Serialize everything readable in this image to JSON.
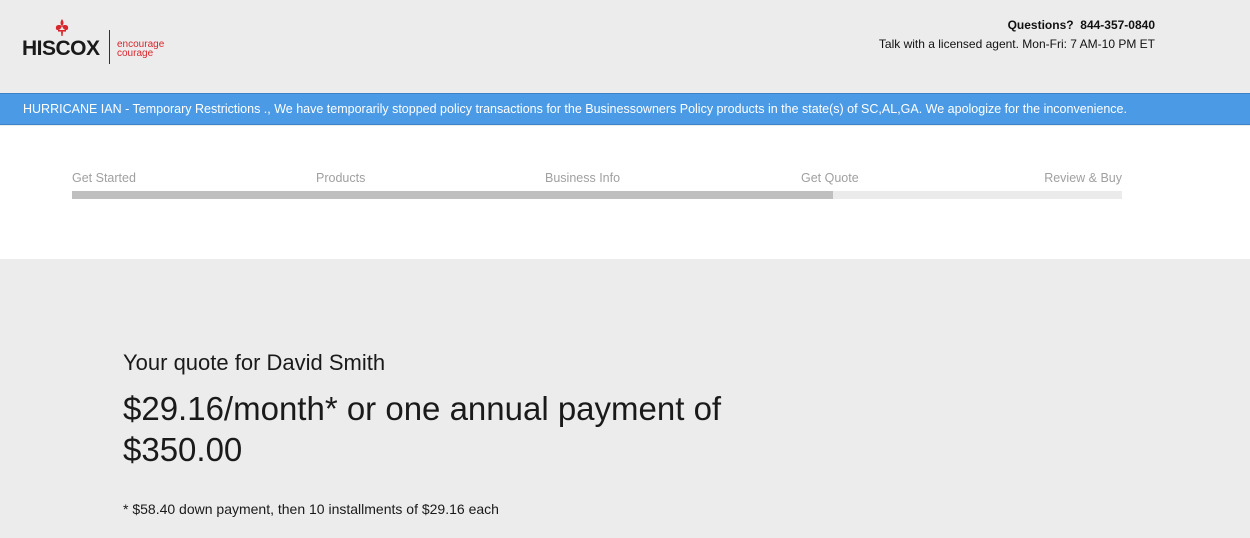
{
  "header": {
    "logo_text": "HISCOX",
    "logo_tagline_1": "encourage",
    "logo_tagline_2": "courage",
    "contact_label": "Questions?",
    "contact_phone": "844-357-0840",
    "contact_hours": "Talk with a licensed agent.  Mon-Fri: 7 AM-10 PM ET"
  },
  "alert": {
    "text": "HURRICANE IAN - Temporary Restrictions ., We have temporarily stopped policy transactions for the Businessowners Policy products in the state(s) of SC,AL,GA. We apologize for the inconvenience."
  },
  "progress": {
    "steps": [
      "Get Started",
      "Products",
      "Business Info",
      "Get Quote",
      "Review & Buy"
    ],
    "completed_fraction": 0.725
  },
  "quote": {
    "title": "Your quote for David Smith",
    "price_line": "$29.16/month* or one annual payment of $350.00",
    "note": "* $58.40 down payment, then 10 installments of $29.16 each"
  },
  "colors": {
    "brand_red": "#d9262c",
    "alert_blue": "#4a9ae6",
    "progress_fill": "#bfbfbf",
    "progress_track": "#ebebeb"
  }
}
